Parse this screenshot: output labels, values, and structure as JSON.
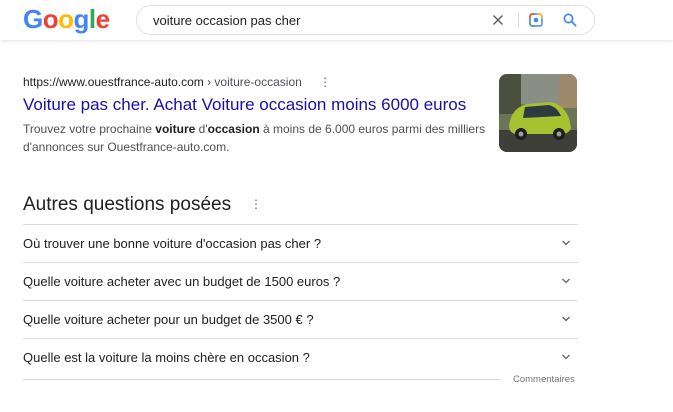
{
  "header": {
    "logo_letters": [
      {
        "ch": "G",
        "color": "#4285f4"
      },
      {
        "ch": "o",
        "color": "#ea4335"
      },
      {
        "ch": "o",
        "color": "#fbbc05"
      },
      {
        "ch": "g",
        "color": "#4285f4"
      },
      {
        "ch": "l",
        "color": "#34a853"
      },
      {
        "ch": "e",
        "color": "#ea4335"
      }
    ],
    "search_query": "voiture occasion pas cher",
    "icons": [
      "clear-icon",
      "camera-lens-icon",
      "search-icon"
    ]
  },
  "result": {
    "url_domain": "https://www.ouestfrance-auto.com",
    "url_path": " › voiture-occasion",
    "title": "Voiture pas cher. Achat Voiture occasion moins 6000 euros",
    "snippet_parts": [
      {
        "text": "Trouvez votre prochaine ",
        "bold": false
      },
      {
        "text": "voiture",
        "bold": true
      },
      {
        "text": " d'",
        "bold": false
      },
      {
        "text": "occasion",
        "bold": true
      },
      {
        "text": " à moins de 6.000 euros parmi des milliers d'annonces sur Ouestfrance-auto.com.",
        "bold": false
      }
    ],
    "thumbnail_icon": "green-car-photo"
  },
  "paa": {
    "title": "Autres questions posées",
    "questions": [
      "Où trouver une bonne voiture d'occasion pas cher ?",
      "Quelle voiture acheter avec un budget de 1500 euros ?",
      "Quelle voiture acheter pour un budget de 3500 € ?",
      "Quelle est la voiture la moins chère en occasion ?"
    ]
  },
  "footer": {
    "feedback": "Commentaires"
  },
  "colors": {
    "link": "#1a0dab",
    "text": "#202124",
    "muted": "#4d5156",
    "border": "#dadce0"
  }
}
